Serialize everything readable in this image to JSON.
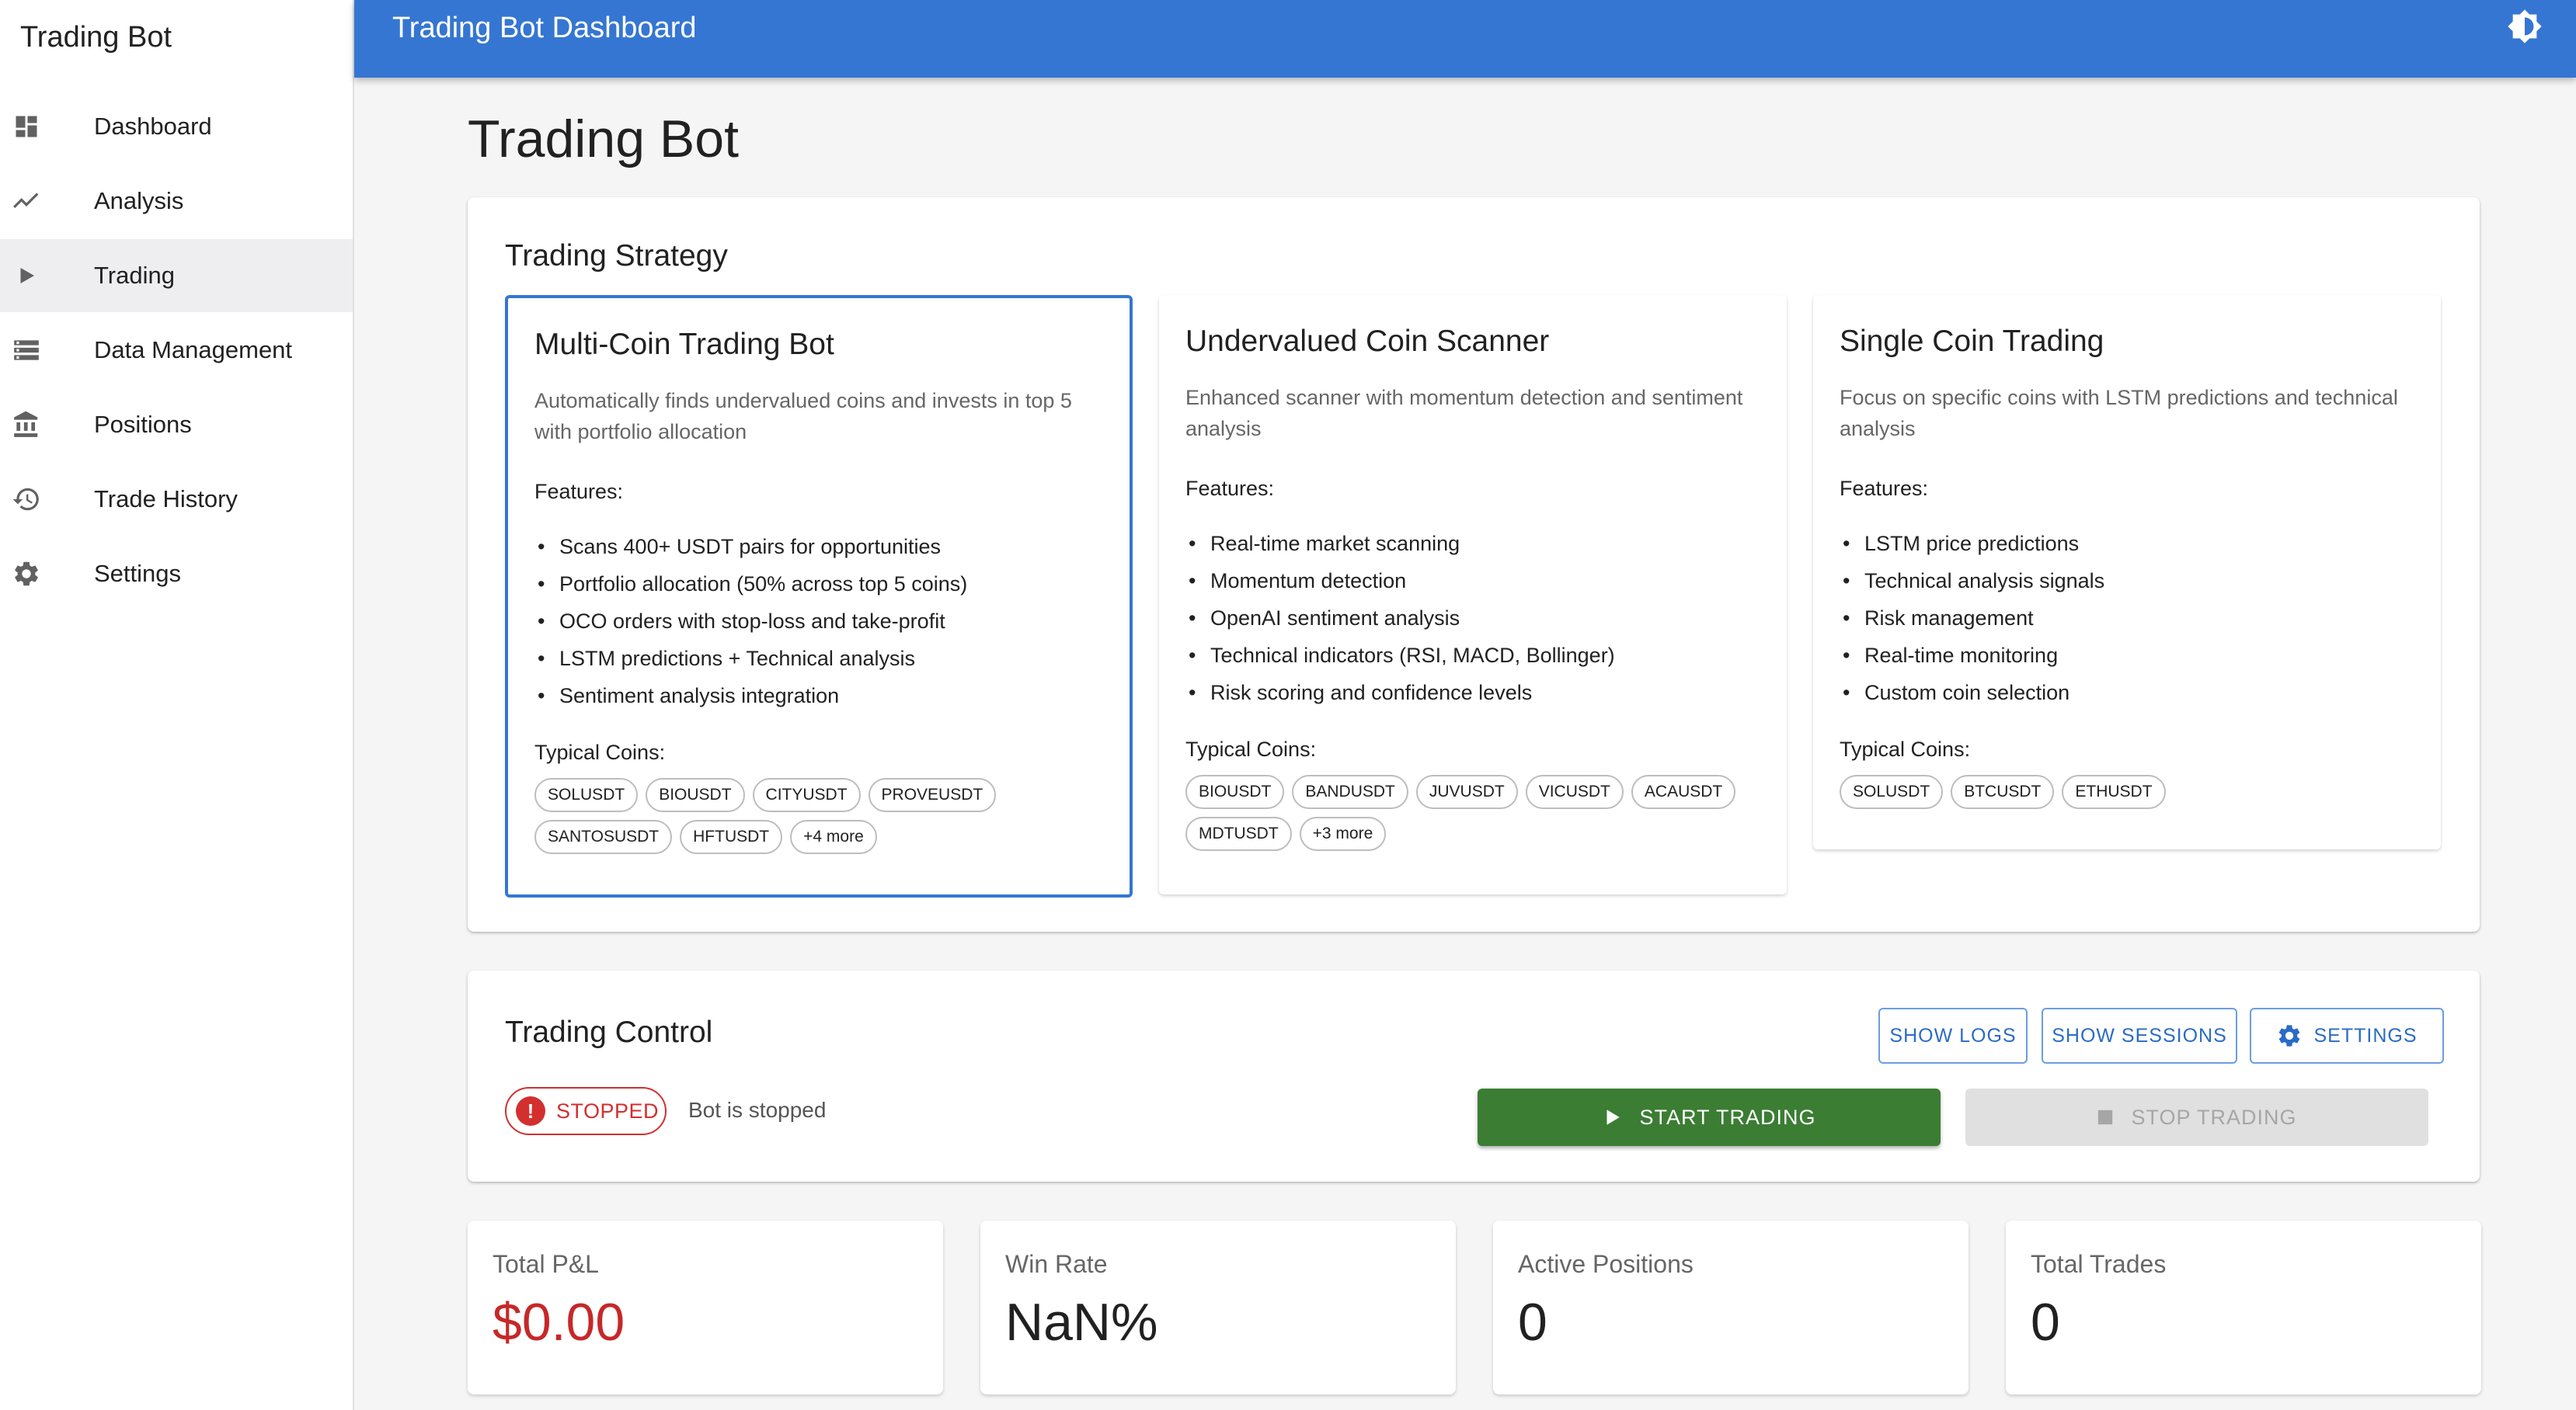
{
  "sidebar": {
    "brand": "Trading Bot",
    "items": [
      {
        "label": "Dashboard",
        "icon": "dashboard-icon"
      },
      {
        "label": "Analysis",
        "icon": "trending-icon"
      },
      {
        "label": "Trading",
        "icon": "play-icon",
        "active": true
      },
      {
        "label": "Data Management",
        "icon": "storage-icon"
      },
      {
        "label": "Positions",
        "icon": "bank-icon"
      },
      {
        "label": "Trade History",
        "icon": "history-icon"
      },
      {
        "label": "Settings",
        "icon": "gear-icon"
      }
    ]
  },
  "appbar": {
    "title": "Trading Bot Dashboard",
    "theme_icon": "brightness-icon"
  },
  "page": {
    "title": "Trading Bot"
  },
  "strategy": {
    "title": "Trading Strategy",
    "features_label": "Features:",
    "coins_label": "Typical Coins:",
    "cards": [
      {
        "title": "Multi-Coin Trading Bot",
        "description": "Automatically finds undervalued coins and invests in top 5 with portfolio allocation",
        "features": [
          "Scans 400+ USDT pairs for opportunities",
          "Portfolio allocation (50% across top 5 coins)",
          "OCO orders with stop-loss and take-profit",
          "LSTM predictions + Technical analysis",
          "Sentiment analysis integration"
        ],
        "coins": [
          "SOLUSDT",
          "BIOUSDT",
          "CITYUSDT",
          "PROVEUSDT",
          "SANTOSUSDT",
          "HFTUSDT",
          "+4 more"
        ],
        "selected": true
      },
      {
        "title": "Undervalued Coin Scanner",
        "description": "Enhanced scanner with momentum detection and sentiment analysis",
        "features": [
          "Real-time market scanning",
          "Momentum detection",
          "OpenAI sentiment analysis",
          "Technical indicators (RSI, MACD, Bollinger)",
          "Risk scoring and confidence levels"
        ],
        "coins": [
          "BIOUSDT",
          "BANDUSDT",
          "JUVUSDT",
          "VICUSDT",
          "ACAUSDT",
          "MDTUSDT",
          "+3 more"
        ],
        "selected": false
      },
      {
        "title": "Single Coin Trading",
        "description": "Focus on specific coins with LSTM predictions and technical analysis",
        "features": [
          "LSTM price predictions",
          "Technical analysis signals",
          "Risk management",
          "Real-time monitoring",
          "Custom coin selection"
        ],
        "coins": [
          "SOLUSDT",
          "BTCUSDT",
          "ETHUSDT"
        ],
        "selected": false
      }
    ]
  },
  "control": {
    "title": "Trading Control",
    "show_logs": "SHOW LOGS",
    "show_sessions": "SHOW SESSIONS",
    "settings": "SETTINGS",
    "status": "STOPPED",
    "status_message": "Bot is stopped",
    "start": "START TRADING",
    "stop": "STOP TRADING"
  },
  "stats": [
    {
      "label": "Total P&L",
      "value": "$0.00",
      "color": "#c62828"
    },
    {
      "label": "Win Rate",
      "value": "NaN%",
      "color": "#212121"
    },
    {
      "label": "Active Positions",
      "value": "0",
      "color": "#212121"
    },
    {
      "label": "Total Trades",
      "value": "0",
      "color": "#212121"
    }
  ]
}
